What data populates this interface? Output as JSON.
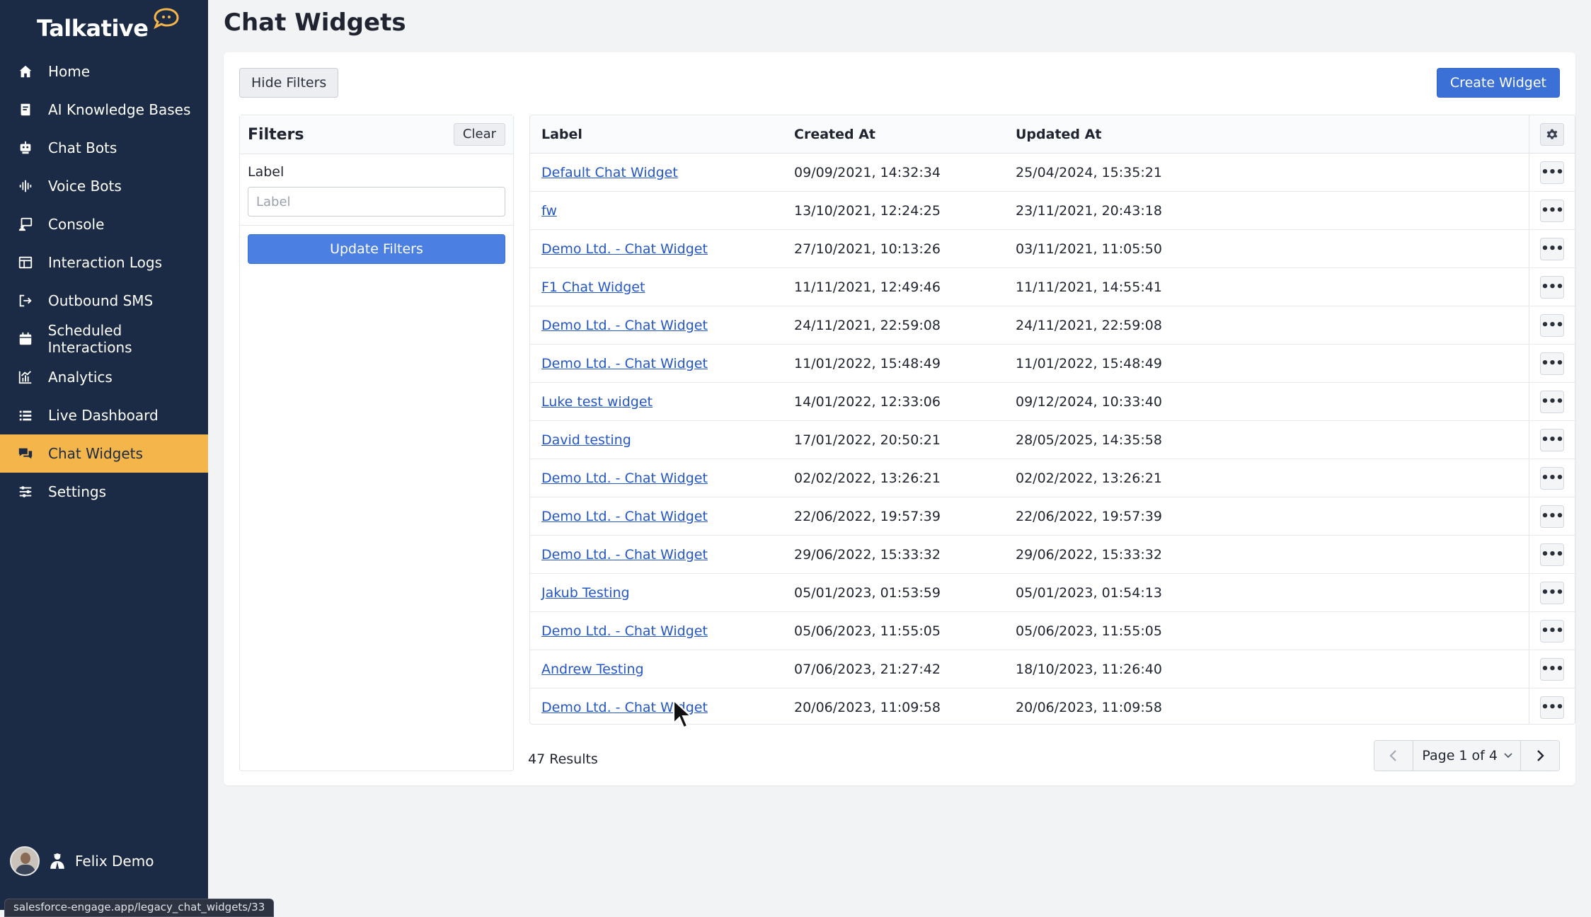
{
  "app": {
    "logo_text": "Talkative",
    "page_title": "Chat Widgets",
    "status_url": "salesforce-engage.app/legacy_chat_widgets/33"
  },
  "sidebar": {
    "items": [
      {
        "label": "Home",
        "icon": "home-icon"
      },
      {
        "label": "AI Knowledge Bases",
        "icon": "book-icon"
      },
      {
        "label": "Chat Bots",
        "icon": "robot-icon"
      },
      {
        "label": "Voice Bots",
        "icon": "waveform-icon"
      },
      {
        "label": "Console",
        "icon": "console-icon"
      },
      {
        "label": "Interaction Logs",
        "icon": "table-icon"
      },
      {
        "label": "Outbound SMS",
        "icon": "outbound-icon"
      },
      {
        "label": "Scheduled Interactions",
        "icon": "calendar-icon"
      },
      {
        "label": "Analytics",
        "icon": "chart-icon"
      },
      {
        "label": "Live Dashboard",
        "icon": "list-icon"
      },
      {
        "label": "Chat Widgets",
        "icon": "chat-icon",
        "active": true
      },
      {
        "label": "Settings",
        "icon": "sliders-icon"
      }
    ],
    "user_name": "Felix Demo"
  },
  "toolbar": {
    "hide_filters": "Hide Filters",
    "create_widget": "Create Widget"
  },
  "filters": {
    "title": "Filters",
    "clear": "Clear",
    "label_title": "Label",
    "label_placeholder": "Label",
    "label_value": "",
    "update": "Update Filters"
  },
  "table": {
    "columns": [
      "Label",
      "Created At",
      "Updated At"
    ],
    "rows": [
      {
        "label": "Default Chat Widget",
        "created": "09/09/2021, 14:32:34",
        "updated": "25/04/2024, 15:35:21"
      },
      {
        "label": "fw",
        "created": "13/10/2021, 12:24:25",
        "updated": "23/11/2021, 20:43:18"
      },
      {
        "label": "Demo Ltd. - Chat Widget",
        "created": "27/10/2021, 10:13:26",
        "updated": "03/11/2021, 11:05:50"
      },
      {
        "label": "F1 Chat Widget",
        "created": "11/11/2021, 12:49:46",
        "updated": "11/11/2021, 14:55:41"
      },
      {
        "label": "Demo Ltd. - Chat Widget",
        "created": "24/11/2021, 22:59:08",
        "updated": "24/11/2021, 22:59:08"
      },
      {
        "label": "Demo Ltd. - Chat Widget",
        "created": "11/01/2022, 15:48:49",
        "updated": "11/01/2022, 15:48:49"
      },
      {
        "label": "Luke test widget",
        "created": "14/01/2022, 12:33:06",
        "updated": "09/12/2024, 10:33:40"
      },
      {
        "label": "David testing",
        "created": "17/01/2022, 20:50:21",
        "updated": "28/05/2025, 14:35:58"
      },
      {
        "label": "Demo Ltd. - Chat Widget",
        "created": "02/02/2022, 13:26:21",
        "updated": "02/02/2022, 13:26:21"
      },
      {
        "label": "Demo Ltd. - Chat Widget",
        "created": "22/06/2022, 19:57:39",
        "updated": "22/06/2022, 19:57:39"
      },
      {
        "label": "Demo Ltd. - Chat Widget",
        "created": "29/06/2022, 15:33:32",
        "updated": "29/06/2022, 15:33:32"
      },
      {
        "label": "Jakub Testing",
        "created": "05/01/2023, 01:53:59",
        "updated": "05/01/2023, 01:54:13"
      },
      {
        "label": "Demo Ltd. - Chat Widget",
        "created": "05/06/2023, 11:55:05",
        "updated": "05/06/2023, 11:55:05"
      },
      {
        "label": "Andrew Testing",
        "created": "07/06/2023, 21:27:42",
        "updated": "18/10/2023, 11:26:40"
      },
      {
        "label": "Demo Ltd. - Chat Widget",
        "created": "20/06/2023, 11:09:58",
        "updated": "20/06/2023, 11:09:58"
      }
    ]
  },
  "footer": {
    "results": "47 Results",
    "page_label": "Page 1 of 4"
  },
  "colors": {
    "sidebar_bg": "#1b2b45",
    "active_item": "#f4b54a",
    "primary": "#3b71d6",
    "link": "#2457c5"
  }
}
